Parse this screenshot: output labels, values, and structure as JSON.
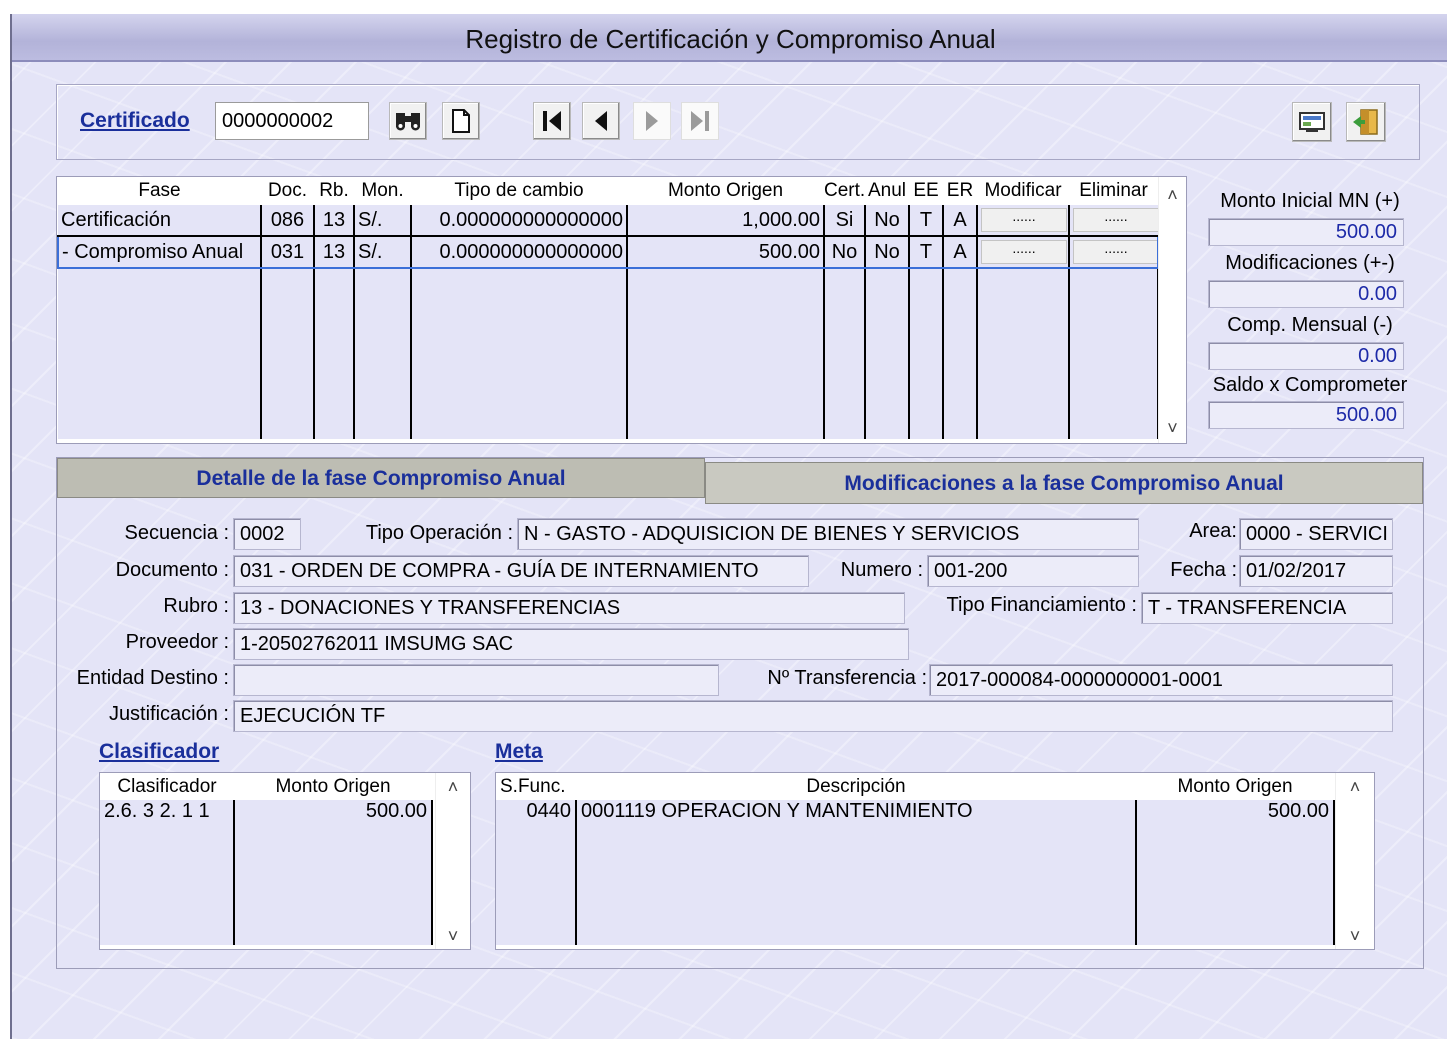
{
  "window": {
    "title": "Registro de Certificación y Compromiso Anual"
  },
  "toolbar": {
    "certificado_label": "Certificado",
    "certificado_value": "0000000002",
    "find_icon": "binoculars-icon",
    "new_icon": "new-document-icon",
    "first_icon": "first-record-icon",
    "prev_icon": "previous-record-icon",
    "next_icon": "next-record-icon",
    "last_icon": "last-record-icon",
    "report_icon": "report-icon",
    "exit_icon": "exit-door-icon"
  },
  "grid": {
    "columns": [
      "Fase",
      "Doc.",
      "Rb.",
      "Mon.",
      "Tipo de cambio",
      "Monto Origen",
      "Cert.",
      "Anul",
      "EE",
      "ER",
      "Modificar",
      "Eliminar"
    ],
    "rows": [
      {
        "fase": "Certificación",
        "doc": "086",
        "rb": "13",
        "mon": "S/.",
        "tipo_cambio": "0.000000000000000",
        "monto": "1,000.00",
        "cert": "Si",
        "anul": "No",
        "ee": "T",
        "er": "A",
        "modificar": "......",
        "eliminar": "......"
      },
      {
        "fase": "- Compromiso Anual",
        "doc": "031",
        "rb": "13",
        "mon": "S/.",
        "tipo_cambio": "0.000000000000000",
        "monto": "500.00",
        "cert": "No",
        "anul": "No",
        "ee": "T",
        "er": "A",
        "modificar": "......",
        "eliminar": "......"
      }
    ]
  },
  "summary": {
    "monto_inicial_label": "Monto Inicial MN (+)",
    "monto_inicial_value": "500.00",
    "modificaciones_label": "Modificaciones (+-)",
    "modificaciones_value": "0.00",
    "comp_mensual_label": "Comp. Mensual (-)",
    "comp_mensual_value": "0.00",
    "saldo_label": "Saldo x Comprometer",
    "saldo_value": "500.00"
  },
  "tabs": {
    "detalle": "Detalle de la fase Compromiso Anual",
    "modificaciones": "Modificaciones a la fase Compromiso Anual"
  },
  "detail": {
    "secuencia_label": "Secuencia :",
    "secuencia_value": "0002",
    "tipo_operacion_label": "Tipo Operación :",
    "tipo_operacion_value": "N  - GASTO - ADQUISICION DE BIENES Y SERVICIOS",
    "area_label": "Area:",
    "area_value": "0000 - SERVICI",
    "documento_label": "Documento :",
    "documento_value": "031 - ORDEN DE COMPRA - GUÍA DE INTERNAMIENTO",
    "numero_label": "Numero :",
    "numero_value": "001-200",
    "fecha_label": "Fecha :",
    "fecha_value": "01/02/2017",
    "rubro_label": "Rubro :",
    "rubro_value": "13 - DONACIONES Y TRANSFERENCIAS",
    "tipo_financiamiento_label": "Tipo Financiamiento :",
    "tipo_financiamiento_value": "T - TRANSFERENCIA",
    "proveedor_label": "Proveedor :",
    "proveedor_value": "1-20502762011   IMSUMG SAC",
    "entidad_destino_label": "Entidad Destino :",
    "entidad_destino_value": "",
    "transferencia_label": "Nº Transferencia :",
    "transferencia_value": "2017-000084-0000000001-0001",
    "justificacion_label": "Justificación :",
    "justificacion_value": "EJECUCIÓN TF"
  },
  "clasificador": {
    "title": "Clasificador",
    "columns": [
      "Clasificador",
      "Monto Origen"
    ],
    "rows": [
      {
        "clasificador": "2.6. 3 2. 1 1",
        "monto": "500.00"
      }
    ]
  },
  "meta": {
    "title": "Meta",
    "columns": [
      "S.Func.",
      "Descripción",
      "Monto Origen"
    ],
    "rows": [
      {
        "sfunc": "0440",
        "descripcion": "0001119  OPERACION Y MANTENIMIENTO",
        "monto": "500.00"
      }
    ]
  }
}
